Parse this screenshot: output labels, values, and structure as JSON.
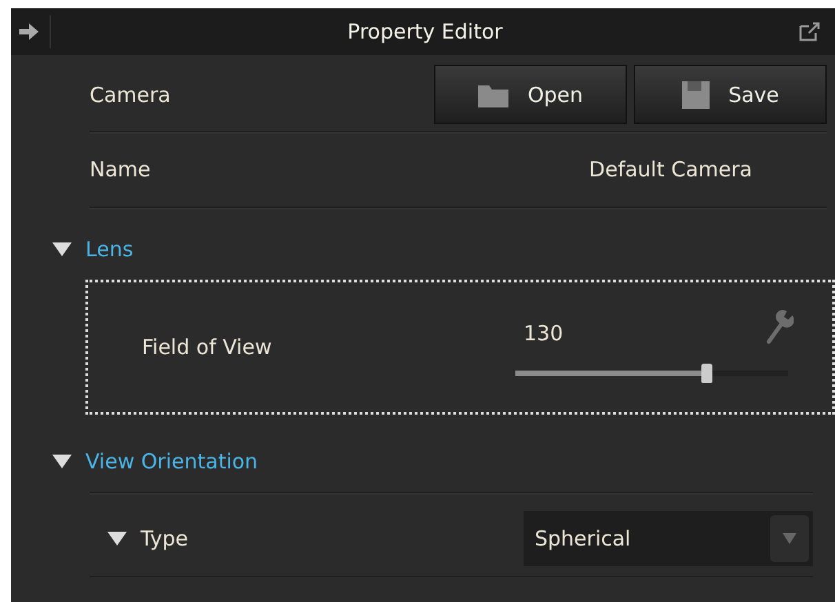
{
  "window": {
    "title": "Property Editor"
  },
  "camera": {
    "label": "Camera",
    "buttons": [
      {
        "kind": "open",
        "label": "Open"
      },
      {
        "kind": "save",
        "label": "Save"
      }
    ]
  },
  "name": {
    "label": "Name",
    "value": "Default Camera"
  },
  "sections": [
    {
      "title": "Lens",
      "expanded": true,
      "rows": [
        {
          "kind": "slider",
          "label": "Field of View",
          "focused": true,
          "reading": "130",
          "level": 0.7
        }
      ]
    },
    {
      "title": "View Orientation",
      "expanded": true,
      "rows": [
        {
          "kind": "dropdown",
          "label": "Type",
          "expanded": true,
          "value": "Spherical"
        }
      ]
    }
  ]
}
